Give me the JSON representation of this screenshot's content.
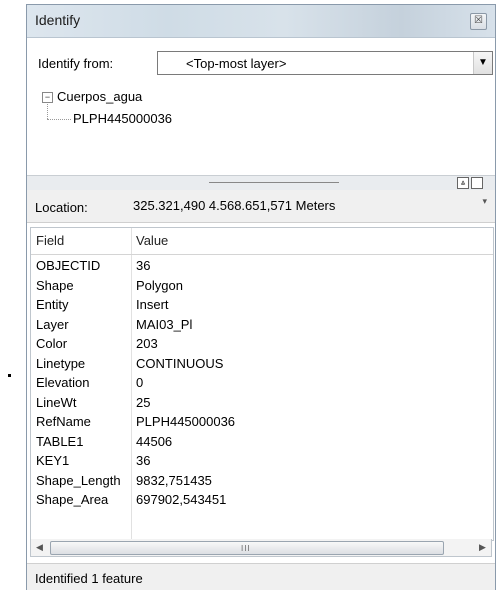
{
  "window": {
    "title": "Identify",
    "close_glyph": "☒"
  },
  "identify_from": {
    "label": "Identify from:",
    "value": "<Top-most layer>",
    "arrow_glyph": "▼"
  },
  "tree": {
    "root": "Cuerpos_agua",
    "child": "PLPH445000036",
    "expander_glyph": "−"
  },
  "location": {
    "label": "Location:",
    "value": "325.321,490  4.568.651,571 Meters"
  },
  "table": {
    "headers": {
      "field": "Field",
      "value": "Value"
    },
    "rows": [
      {
        "field": "OBJECTID",
        "value": "36"
      },
      {
        "field": "Shape",
        "value": "Polygon"
      },
      {
        "field": "Entity",
        "value": "Insert"
      },
      {
        "field": "Layer",
        "value": "MAI03_Pl"
      },
      {
        "field": "Color",
        "value": "203"
      },
      {
        "field": "Linetype",
        "value": "CONTINUOUS"
      },
      {
        "field": "Elevation",
        "value": "0"
      },
      {
        "field": "LineWt",
        "value": "25"
      },
      {
        "field": "RefName",
        "value": "PLPH445000036"
      },
      {
        "field": "TABLE1",
        "value": "44506"
      },
      {
        "field": "KEY1",
        "value": "36"
      },
      {
        "field": "Shape_Length",
        "value": "9832,751435"
      },
      {
        "field": "Shape_Area",
        "value": "697902,543451"
      }
    ]
  },
  "status": {
    "text": "Identified 1 feature"
  },
  "icons": [
    "close-icon",
    "dropdown-arrow-icon",
    "tree-collapse-icon",
    "scroll-left-icon",
    "scroll-right-icon"
  ]
}
